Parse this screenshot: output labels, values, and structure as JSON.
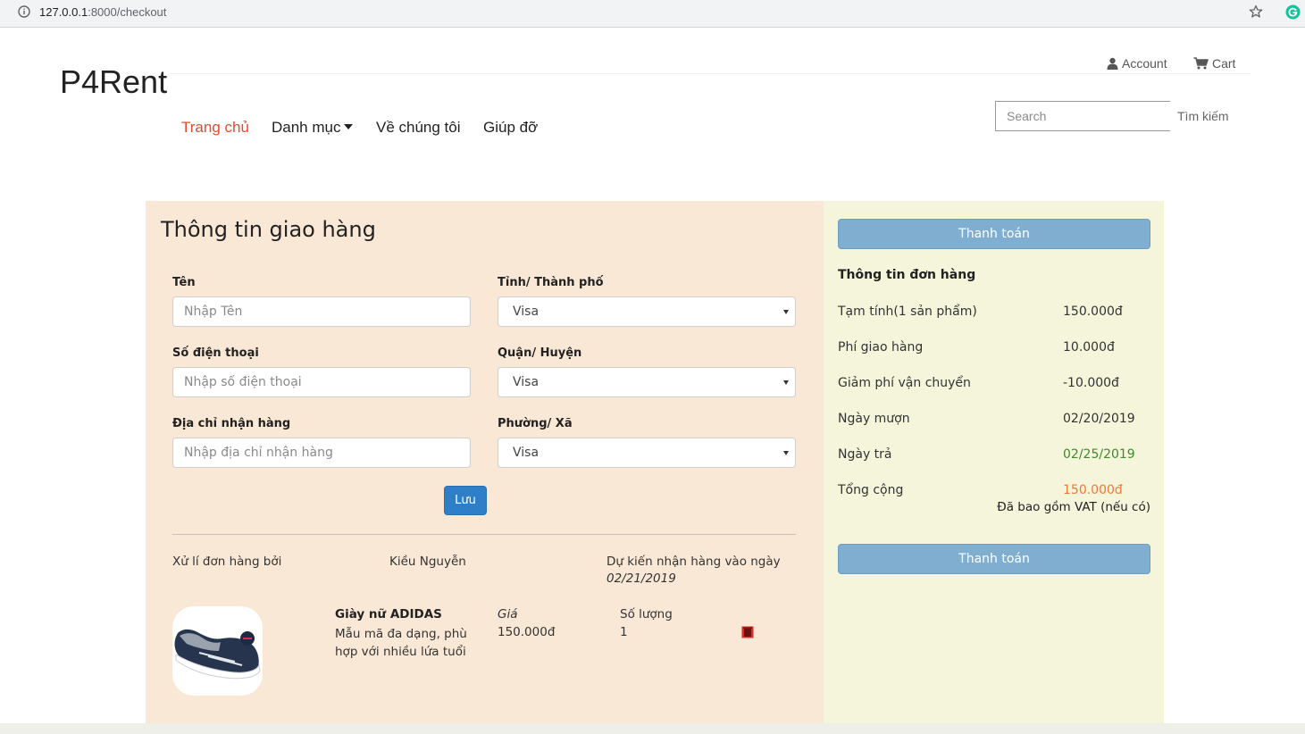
{
  "browser": {
    "url_host": "127.0.0.1",
    "url_rest": ":8000/checkout"
  },
  "header": {
    "brand": "P4Rent",
    "account_label": "Account",
    "cart_label": "Cart",
    "nav": [
      {
        "label": "Trang chủ",
        "active": true
      },
      {
        "label": "Danh mục",
        "has_dropdown": true
      },
      {
        "label": "Về chúng tôi"
      },
      {
        "label": "Giúp đỡ"
      }
    ],
    "search": {
      "placeholder": "Search",
      "value": "",
      "button_label": "Tìm kiếm"
    }
  },
  "shipping": {
    "title": "Thông tin giao hàng",
    "name": {
      "label": "Tên",
      "placeholder": "Nhập Tên",
      "value": ""
    },
    "phone": {
      "label": "Số điện thoại",
      "placeholder": "Nhập số điện thoại",
      "value": ""
    },
    "address": {
      "label": "Địa chỉ nhận hàng",
      "placeholder": "Nhập địa chỉ nhận hàng",
      "value": ""
    },
    "city": {
      "label": "Tỉnh/ Thành phố",
      "selected": "Visa"
    },
    "district": {
      "label": "Quận/ Huyện",
      "selected": "Visa"
    },
    "ward": {
      "label": "Phường/ Xã",
      "selected": "Visa"
    },
    "save_label": "Lưu",
    "handled_by_label": "Xử lí đơn hàng bởi",
    "handler_name": "Kiều Nguyễn",
    "expected_label": "Dự kiến nhận hàng vào ngày",
    "expected_date": "02/21/2019",
    "product": {
      "name": "Giày nữ ADIDAS",
      "description": "Mẫu mã đa dạng, phù hợp với nhiều lứa tuổi",
      "price_label": "Giá",
      "price": "150.000đ",
      "qty_label": "Số lượng",
      "qty": "1",
      "image_icon": "sneaker-image",
      "delete_icon": "trash-icon"
    }
  },
  "order": {
    "pay_label": "Thanh toán",
    "title": "Thông tin đơn hàng",
    "subtotal_label": "Tạm tính(1 sản phẩm)",
    "subtotal": "150.000đ",
    "shipping_label": "Phí giao hàng",
    "shipping": "10.000đ",
    "discount_label": "Giảm phí vận chuyển",
    "discount": "-10.000đ",
    "borrow_label": "Ngày mượn",
    "borrow_date": "02/20/2019",
    "return_label": "Ngày trả",
    "return_date": "02/25/2019",
    "total_label": "Tổng cộng",
    "total": "150.000đ",
    "vat_note": "Đã bao gồm VAT (nếu có)"
  },
  "colors": {
    "nav_active": "#e8492b",
    "left_panel_bg": "#fae8d6",
    "right_panel_bg": "#f5f5dc",
    "pay_button": "#80aed0",
    "save_button": "#2f7fc8",
    "return_date": "#3e8a2c",
    "total": "#f07a32"
  }
}
